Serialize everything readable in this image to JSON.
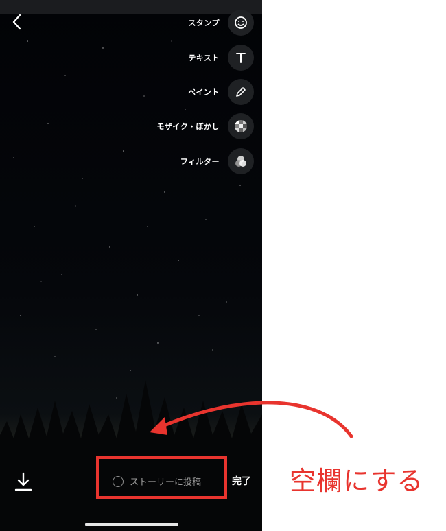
{
  "tools": [
    {
      "label": "スタンプ",
      "icon": "smiley-icon"
    },
    {
      "label": "テキスト",
      "icon": "text-icon"
    },
    {
      "label": "ペイント",
      "icon": "pencil-icon"
    },
    {
      "label": "モザイク・ぼかし",
      "icon": "mosaic-icon"
    },
    {
      "label": "フィルター",
      "icon": "filter-icon"
    }
  ],
  "bottom_bar": {
    "story_label": "ストーリーに投稿",
    "done_label": "完了"
  },
  "annotation": {
    "note": "空欄にする",
    "color": "#e8342e"
  }
}
